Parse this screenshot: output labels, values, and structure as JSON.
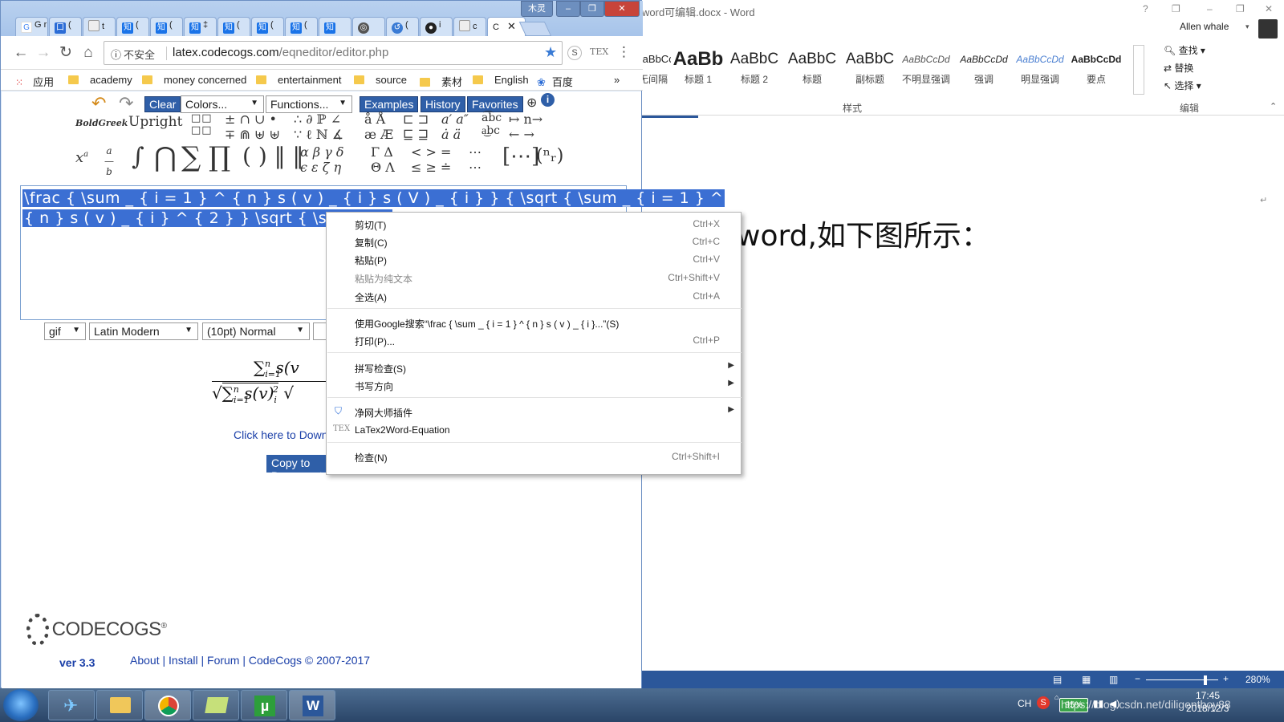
{
  "word": {
    "title": "word可编辑.docx - Word",
    "window_buttons": [
      "?",
      "❐",
      "–",
      "❐",
      "✕"
    ],
    "user": "Allen whale",
    "styles": [
      {
        "sample": "AaBbCcDd",
        "name": "无间隔"
      },
      {
        "sample": "AaBb",
        "name": "标题 1"
      },
      {
        "sample": "AaBbC",
        "name": "标题 2"
      },
      {
        "sample": "AaBbC",
        "name": "标题"
      },
      {
        "sample": "AaBbC",
        "name": "副标题"
      },
      {
        "sample": "AaBbCcDd",
        "name": "不明显强调"
      },
      {
        "sample": "AaBbCcDd",
        "name": "强调"
      },
      {
        "sample": "AaBbCcDd",
        "name": "明显强调"
      },
      {
        "sample": "AaBbCcDd",
        "name": "要点"
      }
    ],
    "styles_group_label": "样式",
    "edit_items": [
      "查找",
      "替换",
      "选择"
    ],
    "edit_group_label": "编辑",
    "doc_text": "word,如下图所示：",
    "zoom": "280%"
  },
  "chrome": {
    "tabs": [
      {
        "label": "G r",
        "icon": "G",
        "color": "#ffffff"
      },
      {
        "label": "(",
        "icon": "口",
        "color": "#2b6cd6"
      },
      {
        "label": "t",
        "icon": "",
        "color": "#dddddd"
      },
      {
        "label": "(",
        "icon": "知",
        "color": "#1a73e8"
      },
      {
        "label": "(",
        "icon": "知",
        "color": "#1a73e8"
      },
      {
        "label": "‡",
        "icon": "知",
        "color": "#1a73e8"
      },
      {
        "label": "(",
        "icon": "知",
        "color": "#1a73e8"
      },
      {
        "label": "(",
        "icon": "知",
        "color": "#1a73e8"
      },
      {
        "label": "(",
        "icon": "知",
        "color": "#1a73e8"
      },
      {
        "label": "",
        "icon": "知",
        "color": "#1a73e8"
      },
      {
        "label": "",
        "icon": "",
        "color": "#555555"
      },
      {
        "label": "(",
        "icon": "",
        "color": "#3a7bd5"
      },
      {
        "label": "i",
        "icon": "",
        "color": "#222222"
      },
      {
        "label": "c",
        "icon": "",
        "color": "#dddddd"
      },
      {
        "label": "C",
        "icon": "",
        "color": "#dddddd"
      }
    ],
    "window_label": "木灵",
    "insecure": "不安全",
    "url_host": "latex.codecogs.com",
    "url_path": "/eqneditor/editor.php",
    "bookmarks": [
      "应用",
      "academy",
      "money concerned",
      "entertainment",
      "source",
      "素材",
      "English",
      "百度"
    ],
    "more": "»"
  },
  "editor": {
    "buttons": {
      "clear": "Clear",
      "examples": "Examples",
      "history": "History",
      "favorites": "Favorites"
    },
    "colors": "Colors...",
    "functions": "Functions...",
    "latex_line1": "\\frac { \\sum _ { i = 1 } ^ { n } s ( v ) _ { i } s ( V ) _ { i } } { \\sqrt { \\sum _ { i = 1 } ^",
    "latex_line2": "{ n } s ( v ) _ { i } ^ { 2 } } \\sqrt { \\sum _ { i",
    "format": "gif",
    "font": "Latin Modern",
    "size": "(10pt) Normal",
    "download_link": "Click here to Down",
    "copy_button": "Copy to Document",
    "logo": "CODECOGS",
    "version": "ver 3.3",
    "footer": [
      "About",
      "Install",
      "Forum",
      "CodeCogs © 2007-2017"
    ]
  },
  "context_menu": {
    "items": [
      {
        "label": "剪切(T)",
        "shortcut": "Ctrl+X"
      },
      {
        "label": "复制(C)",
        "shortcut": "Ctrl+C"
      },
      {
        "label": "粘贴(P)",
        "shortcut": "Ctrl+V"
      },
      {
        "label": "粘贴为纯文本",
        "shortcut": "Ctrl+Shift+V"
      },
      {
        "label": "全选(A)",
        "shortcut": "Ctrl+A"
      },
      {
        "label": "使用Google搜索“\\frac { \\sum _ { i = 1 } ^ { n } s ( v ) _ { i }...”(S)",
        "shortcut": ""
      },
      {
        "label": "打印(P)...",
        "shortcut": "Ctrl+P"
      },
      {
        "label": "拼写检查(S)",
        "shortcut": ""
      },
      {
        "label": "书写方向",
        "shortcut": ""
      },
      {
        "label": "净网大师插件",
        "shortcut": ""
      },
      {
        "label": "LaTex2Word-Equation",
        "shortcut": ""
      },
      {
        "label": "检查(N)",
        "shortcut": "Ctrl+Shift+I"
      }
    ]
  },
  "taskbar": {
    "lang": "CH",
    "battery": "95%",
    "time": "17:45",
    "date": "2018/12/3",
    "watermark": "https://blog.csdn.net/diligentboy88"
  }
}
